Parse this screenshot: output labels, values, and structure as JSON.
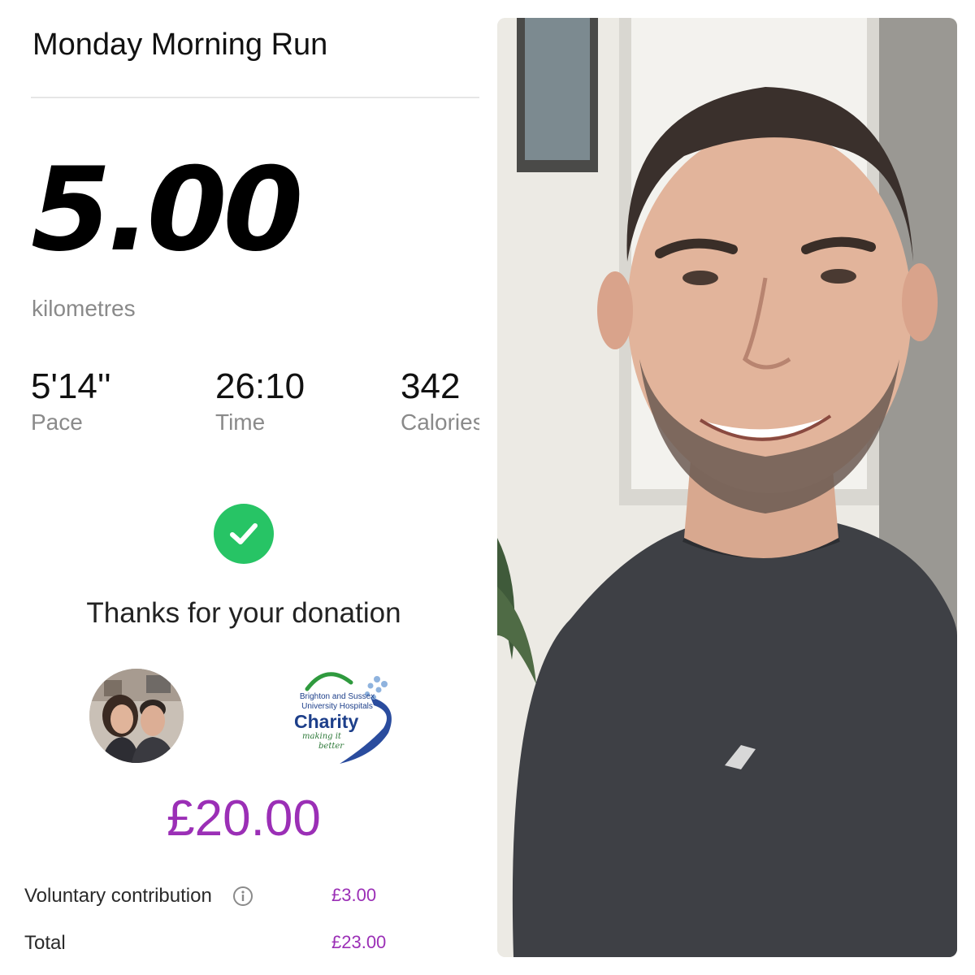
{
  "run": {
    "title": "Monday Morning Run",
    "distance": "5.00",
    "distance_unit": "kilometres",
    "stats": [
      {
        "value": "5'14''",
        "label": "Pace"
      },
      {
        "value": "26:10",
        "label": "Time"
      },
      {
        "value": "342",
        "label": "Calories"
      }
    ]
  },
  "donation": {
    "thanks_message": "Thanks for your donation",
    "amount": "£20.00",
    "charity": {
      "line1": "Brighton and Sussex",
      "line2": "University Hospitals",
      "name": "Charity",
      "tagline1": "making it",
      "tagline2": "better"
    },
    "voluntary_contribution_label": "Voluntary contribution",
    "voluntary_contribution_value": "£3.00",
    "total_label": "Total",
    "total_value": "£23.00"
  },
  "icons": {
    "success": "check-circle-icon",
    "info": "info-icon"
  },
  "colors": {
    "accent_purple": "#9b2fb6",
    "success_green": "#27c465",
    "muted_text": "#8a8a8a"
  }
}
